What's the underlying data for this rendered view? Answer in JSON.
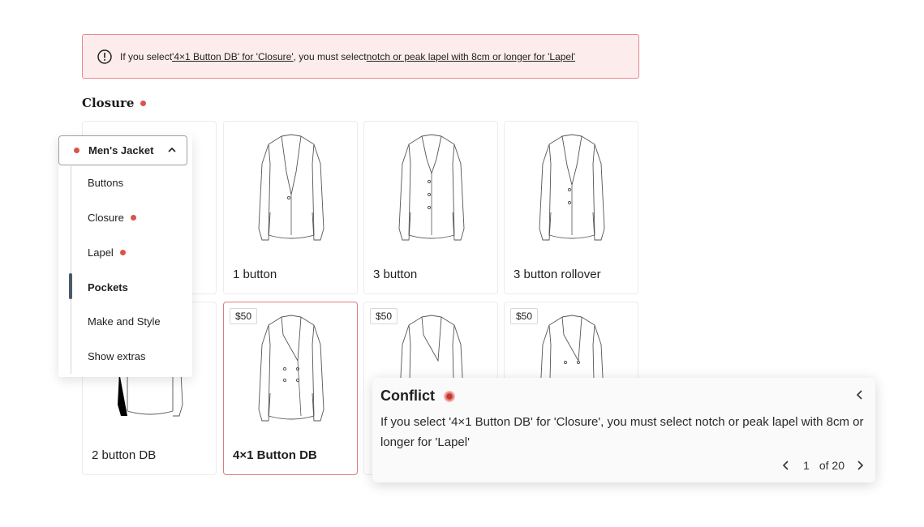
{
  "alert": {
    "prefix": "If you select ",
    "link1": "'4×1 Button DB' for 'Closure'",
    "middle": ", you must select ",
    "link2": "notch or peak lapel with 8cm or longer for 'Lapel'",
    "icon": "exclamation-circle-icon"
  },
  "section": {
    "title": "Closure"
  },
  "options": [
    {
      "label": "1 button"
    },
    {
      "label": "3 button"
    },
    {
      "label": "3 button rollover"
    },
    {
      "label": "2 button DB"
    },
    {
      "label": "4×1 Button DB",
      "price": "$50",
      "selected": true
    },
    {
      "price": "$50"
    },
    {
      "price": "$50"
    }
  ],
  "nav": {
    "header": "Men's Jacket",
    "items": [
      {
        "label": "Buttons"
      },
      {
        "label": "Closure"
      },
      {
        "label": "Lapel"
      },
      {
        "label": "Pockets"
      },
      {
        "label": "Make and Style"
      },
      {
        "label": "Show extras"
      }
    ]
  },
  "conflict": {
    "title": "Conflict",
    "message": "If you select '4×1 Button DB' for 'Closure', you must select notch or peak lapel with 8cm or longer for 'Lapel'",
    "page": "1",
    "of": "of 20"
  },
  "colors": {
    "accent": "#d9534f",
    "alert_bg": "#fdecec",
    "alert_border": "#e58a8a",
    "selected_border": "#e07b7b"
  }
}
